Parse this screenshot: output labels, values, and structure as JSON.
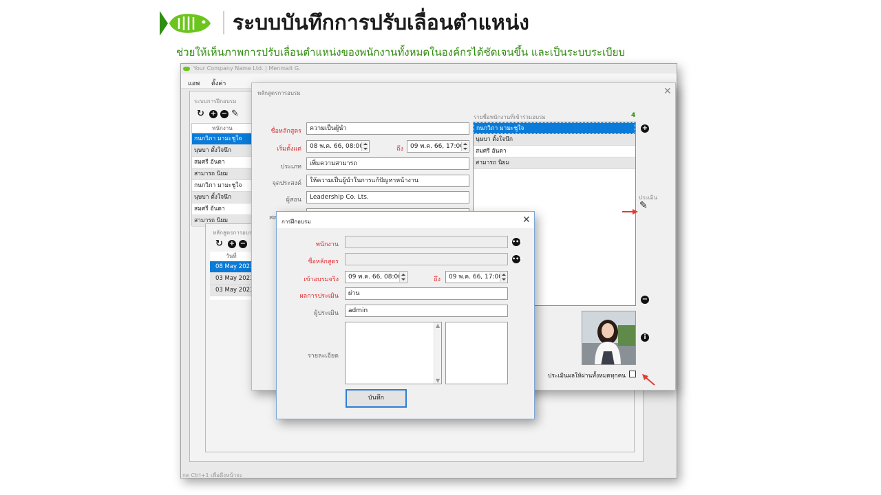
{
  "header": {
    "title": "ระบบบันทึกการปรับเลื่อนตำแหน่ง",
    "subtitle": "ช่วยให้เห็นภาพการปรับเลื่อนตำแหน่งของพนักงานทั้งหมดในองค์กรได้ชัดเจนขึ้น และเป็นระบบระเบียบ",
    "brand_color": "#4caf1c",
    "logo_icon": "fish-logo-icon"
  },
  "app": {
    "title": "Your Company Name Ltd. | Menmait G.",
    "menu": [
      "แอพ",
      "ตั้งค่า"
    ],
    "status": "กด Ctrl+1 เพื่อดึงหน้าจะ"
  },
  "training_window": {
    "title": "ระบบการฝึกอบรม",
    "column_header": "พนักงาน",
    "employees": [
      "กนกวิภา มามะชูใจ",
      "นุษบา ตั้งใจนึก",
      "สมศรี อันดา",
      "สามารถ นิยม",
      "กนกวิภา มามะชูใจ",
      "นุษบา ตั้งใจนึก",
      "สมศรี อันดา",
      "สามารถ นิยม"
    ]
  },
  "course_list_window": {
    "title": "หลักสูตรการอบรม",
    "column_header": "วันที่",
    "dates": [
      "08 May 2023",
      "03 May 2023",
      "03 May 2023"
    ]
  },
  "course_dialog": {
    "title": "หลักสูตรการอบรม",
    "labels": {
      "name": "ชื่อหลักสูตร",
      "start": "เริ่มตั้งแต่",
      "to": "ถึง",
      "type": "ประเภท",
      "purpose": "จุดประสงค์",
      "instructor": "ผู้สอน",
      "place": "สถ"
    },
    "values": {
      "name": "ความเป็นผู้นำ",
      "start": "08 พ.ค. 66, 08:00",
      "end": "09 พ.ค. 66, 17:00",
      "type": "เพิ่มความสามารถ",
      "purpose": "ให้ความเป็นผู้นำในการแก้ปัญหาหน้างาน",
      "instructor": "Leadership Co. Lts."
    },
    "participants_label": "รายชื่อพนักงานที่เข้าร่วมอบรม",
    "participants_count": "4",
    "participants": [
      "กนกวิภา มามะชูใจ",
      "นุษบา ตั้งใจนึก",
      "สมศรี อันดา",
      "สามารถ นิยม"
    ],
    "evaluate_label": "ประเมิน",
    "pass_all_label": "ประเมินผลให้ผ่านทั้งหมดทุกคน"
  },
  "record_dialog": {
    "title": "การฝึกอบรม",
    "labels": {
      "employee": "พนักงาน",
      "course": "ชื่อหลักสูตร",
      "attend": "เข้าอบรมจริง",
      "to": "ถึง",
      "result": "ผลการประเมิน",
      "evaluator": "ผู้ประเมิน",
      "details": "รายละเอียด"
    },
    "values": {
      "attend_start": "09 พ.ค. 66, 08:00",
      "attend_end": "09 พ.ค. 66, 17:00",
      "result": "ผ่าน",
      "evaluator": "admin"
    },
    "save_label": "บันทึก"
  },
  "colors": {
    "selection": "#0a7bd8",
    "required_label": "#e0282e",
    "annotation_arrow": "#e53935"
  }
}
